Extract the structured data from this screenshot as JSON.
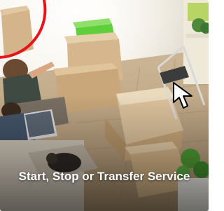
{
  "tile": {
    "title": "Start, Stop or Transfer Service",
    "image_subject": "people moving with cardboard boxes"
  },
  "colors": {
    "accent_arc": "#e8141c",
    "title_text": "#ffffff"
  },
  "icons": {
    "pointer": "mouse-pointer-icon"
  }
}
